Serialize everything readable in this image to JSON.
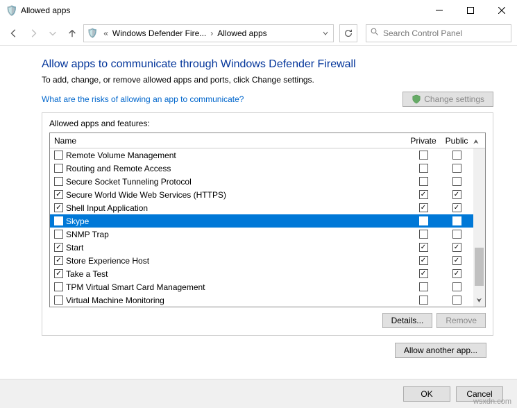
{
  "window": {
    "title": "Allowed apps"
  },
  "nav": {
    "breadcrumb": {
      "seg1": "Windows Defender Fire...",
      "seg2": "Allowed apps"
    },
    "search_placeholder": "Search Control Panel"
  },
  "page": {
    "heading": "Allow apps to communicate through Windows Defender Firewall",
    "subtext": "To add, change, or remove allowed apps and ports, click Change settings.",
    "risk_link": "What are the risks of allowing an app to communicate?",
    "change_settings": "Change settings",
    "group_label": "Allowed apps and features:",
    "col_name": "Name",
    "col_private": "Private",
    "col_public": "Public",
    "details": "Details...",
    "remove": "Remove",
    "allow_another": "Allow another app..."
  },
  "rows": [
    {
      "name": "Remote Volume Management",
      "enabled": false,
      "private": false,
      "public": false,
      "selected": false
    },
    {
      "name": "Routing and Remote Access",
      "enabled": false,
      "private": false,
      "public": false,
      "selected": false
    },
    {
      "name": "Secure Socket Tunneling Protocol",
      "enabled": false,
      "private": false,
      "public": false,
      "selected": false
    },
    {
      "name": "Secure World Wide Web Services (HTTPS)",
      "enabled": true,
      "private": true,
      "public": true,
      "selected": false
    },
    {
      "name": "Shell Input Application",
      "enabled": true,
      "private": true,
      "public": true,
      "selected": false
    },
    {
      "name": "Skype",
      "enabled": true,
      "private": true,
      "public": true,
      "selected": true
    },
    {
      "name": "SNMP Trap",
      "enabled": false,
      "private": false,
      "public": false,
      "selected": false
    },
    {
      "name": "Start",
      "enabled": true,
      "private": true,
      "public": true,
      "selected": false
    },
    {
      "name": "Store Experience Host",
      "enabled": true,
      "private": true,
      "public": true,
      "selected": false
    },
    {
      "name": "Take a Test",
      "enabled": true,
      "private": true,
      "public": true,
      "selected": false
    },
    {
      "name": "TPM Virtual Smart Card Management",
      "enabled": false,
      "private": false,
      "public": false,
      "selected": false
    },
    {
      "name": "Virtual Machine Monitoring",
      "enabled": false,
      "private": false,
      "public": false,
      "selected": false
    }
  ],
  "footer": {
    "ok": "OK",
    "cancel": "Cancel"
  },
  "watermark": "wsxdn.com"
}
